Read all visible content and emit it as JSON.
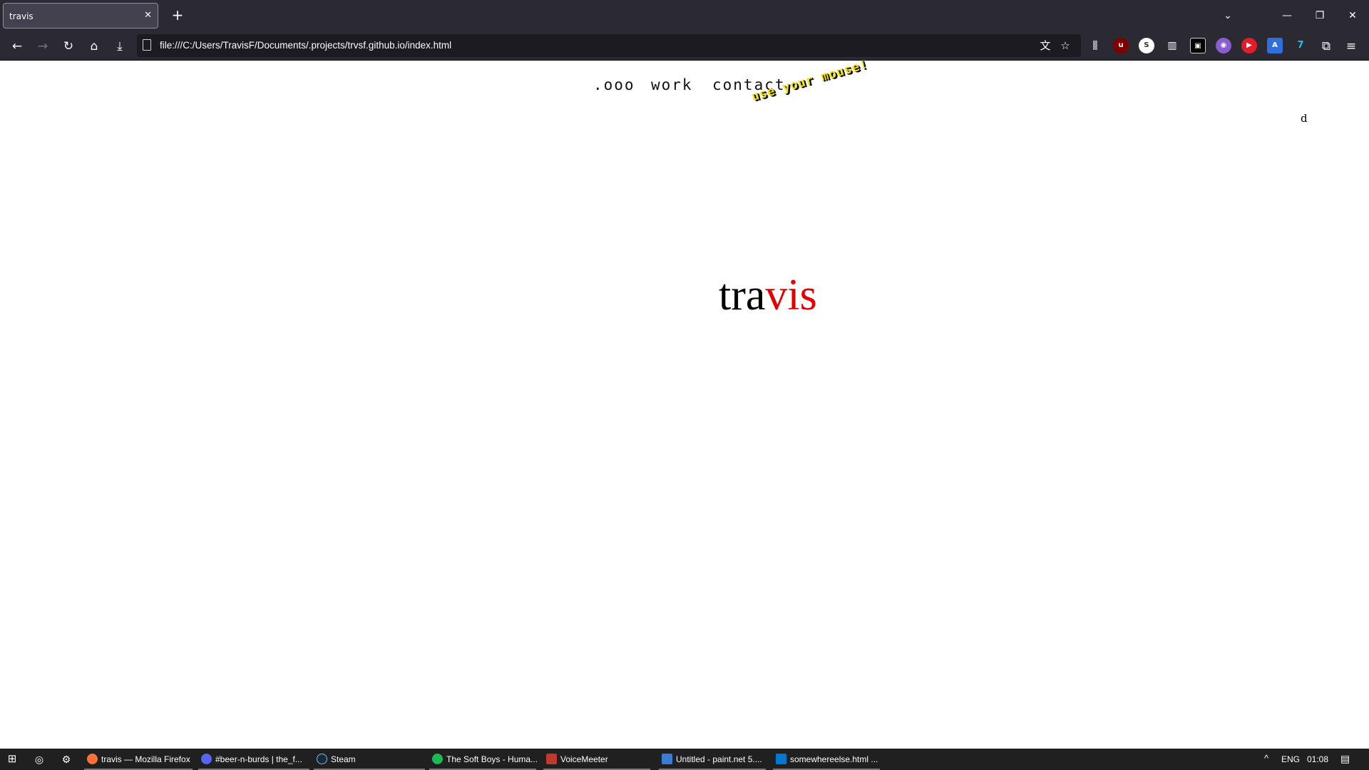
{
  "browser": {
    "tab_title": "travis",
    "url": "file:///C:/Users/TravisF/Documents/.projects/trvsf.github.io/index.html"
  },
  "page": {
    "nav": [
      ".ooo",
      "work",
      "contact"
    ],
    "hint": "use your mouse!",
    "corner_letter": "d",
    "hero_part1": "tra",
    "hero_part2": "vis",
    "hero_color_1": "#000000",
    "hero_color_2": "#e50000",
    "hint_color": "#f5e200"
  },
  "taskbar": {
    "apps": [
      {
        "label": "travis — Mozilla Firefox",
        "icon": "firefox-icon"
      },
      {
        "label": "#beer-n-burds | the_f...",
        "icon": "discord-icon"
      },
      {
        "label": "Steam",
        "icon": "steam-icon"
      },
      {
        "label": "The Soft Boys - Huma...",
        "icon": "spotify-icon"
      },
      {
        "label": "VoiceMeeter",
        "icon": "voicemeeter-icon"
      },
      {
        "label": "Untitled - paint.net 5....",
        "icon": "paintnet-icon"
      },
      {
        "label": "somewhereelse.html ...",
        "icon": "vscode-icon"
      }
    ],
    "language": "ENG",
    "time": "01:08"
  }
}
